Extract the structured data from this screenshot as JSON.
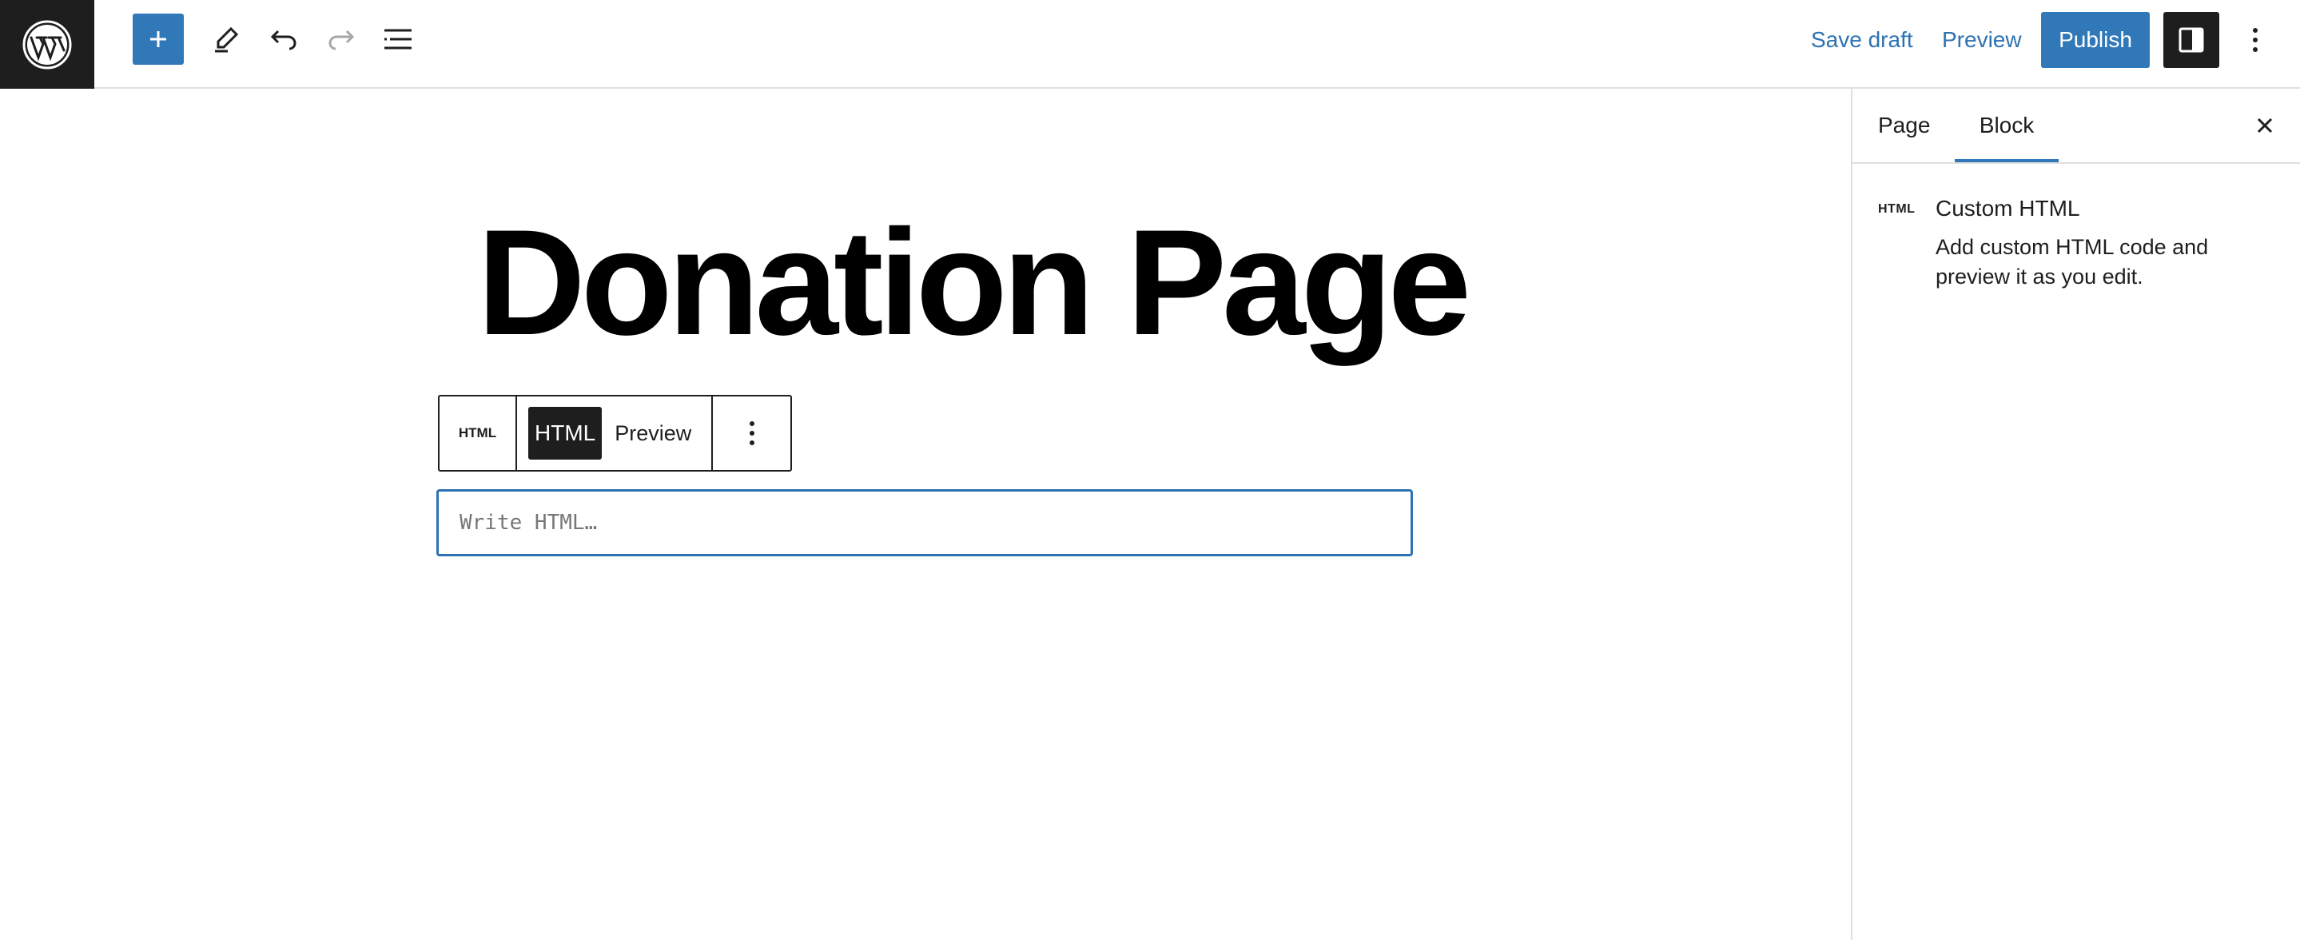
{
  "colors": {
    "accent": "#3178b9",
    "dark": "#1e1e1e",
    "border": "#e0e0e0"
  },
  "header": {
    "logo_icon": "wordpress-logo-icon",
    "inserter_icon": "plus-icon",
    "tools_icon": "pencil-icon",
    "undo_icon": "undo-icon",
    "redo_icon": "redo-icon",
    "list_view_icon": "list-view-icon",
    "save_draft_label": "Save draft",
    "preview_label": "Preview",
    "publish_label": "Publish",
    "settings_icon": "sidebar-toggle-icon",
    "options_icon": "vertical-ellipsis-icon"
  },
  "editor": {
    "page_title": "Donation Page",
    "block_toolbar": {
      "block_type_label": "HTML",
      "mode_html_label": "HTML",
      "mode_preview_label": "Preview",
      "more_icon": "vertical-ellipsis-icon"
    },
    "html_input": {
      "value": "",
      "placeholder": "Write HTML…"
    }
  },
  "sidebar": {
    "tabs": [
      {
        "label": "Page",
        "active": false
      },
      {
        "label": "Block",
        "active": true
      }
    ],
    "close_icon": "close-icon",
    "block_card": {
      "icon_label": "HTML",
      "title": "Custom HTML",
      "description": "Add custom HTML code and preview it as you edit."
    }
  }
}
